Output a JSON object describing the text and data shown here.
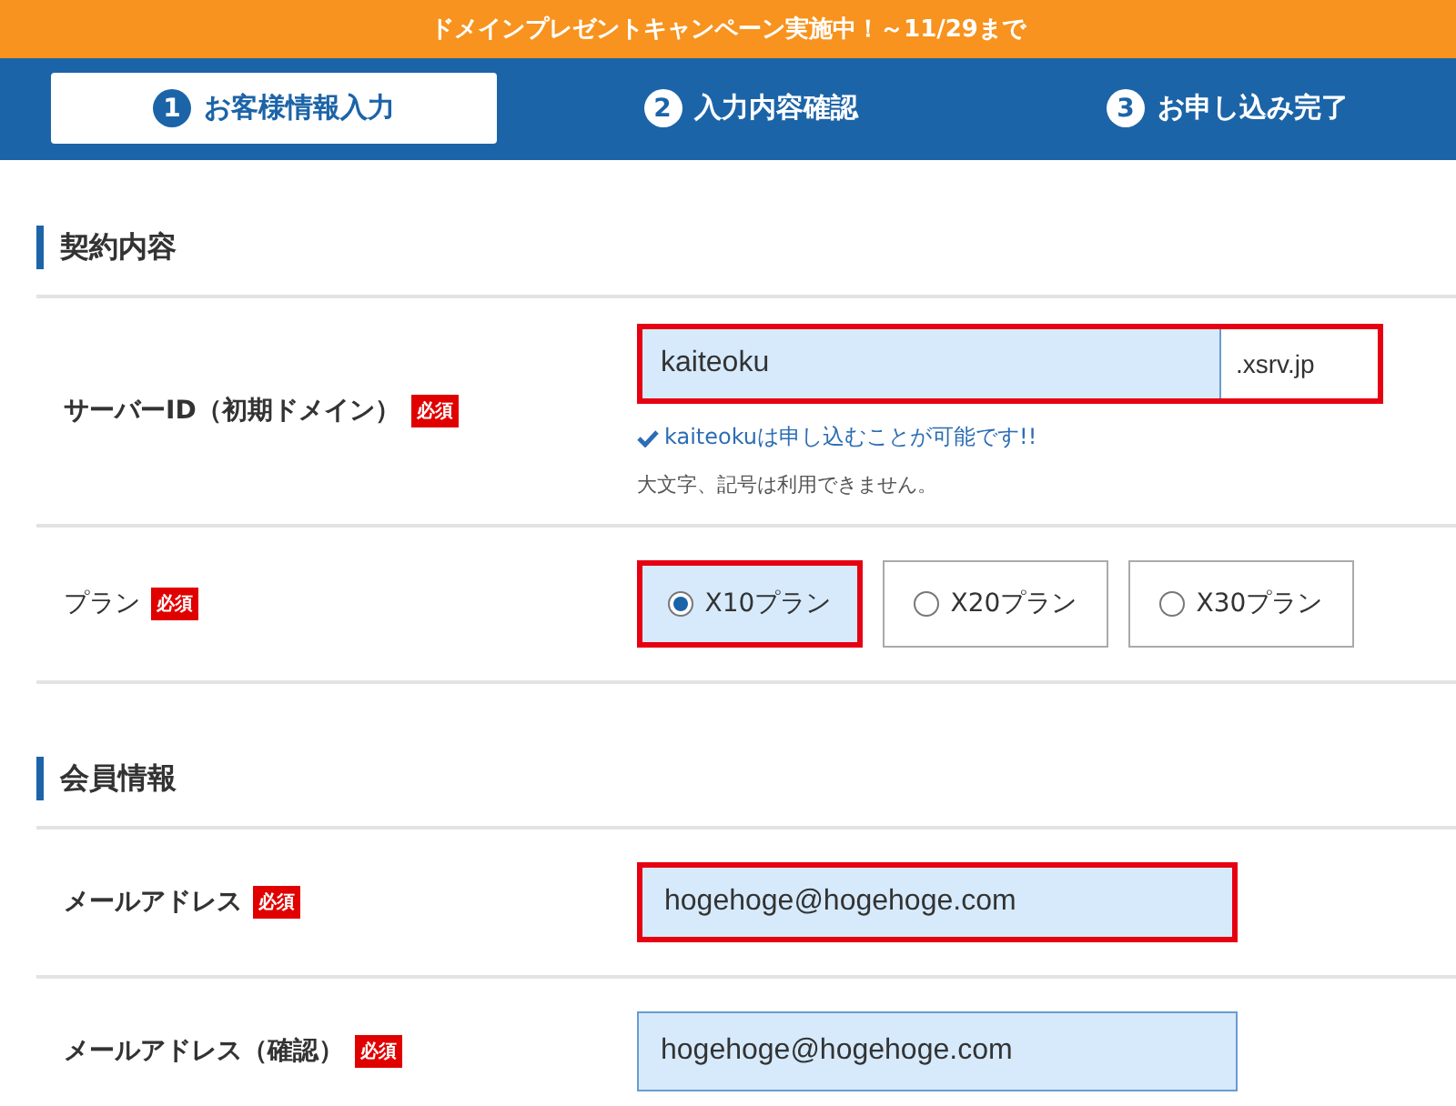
{
  "banner": "ドメインプレゼントキャンペーン実施中！～11/29まで",
  "steps": [
    {
      "number": "1",
      "label": "お客様情報入力",
      "selected": true
    },
    {
      "number": "2",
      "label": "入力内容確認",
      "selected": false
    },
    {
      "number": "3",
      "label": "お申し込み完了",
      "selected": false
    }
  ],
  "sections": [
    {
      "title": "契約内容",
      "rows": [
        {
          "kind": "domain",
          "label": "サーバーID（初期ドメイン）",
          "required_badge": "必須",
          "value": "kaiteoku",
          "suffix": ".xsrv.jp",
          "highlighted": true,
          "ok_message": "kaiteokuは申し込むことが可能です!!",
          "hint": "大文字、記号は利用できません。"
        },
        {
          "kind": "radio",
          "label": "プラン",
          "required_badge": "必須",
          "highlighted": true,
          "options": [
            {
              "label": "X10プラン",
              "selected": true
            },
            {
              "label": "X20プラン",
              "selected": false
            },
            {
              "label": "X30プラン",
              "selected": false
            }
          ]
        }
      ]
    },
    {
      "title": "会員情報",
      "rows": [
        {
          "kind": "text",
          "label": "メールアドレス",
          "required_badge": "必須",
          "value": "hogehoge@hogehoge.com",
          "highlighted": true
        },
        {
          "kind": "text",
          "label": "メールアドレス（確認）",
          "required_badge": "必須",
          "value": "hogehoge@hogehoge.com",
          "highlighted": false
        }
      ]
    }
  ]
}
